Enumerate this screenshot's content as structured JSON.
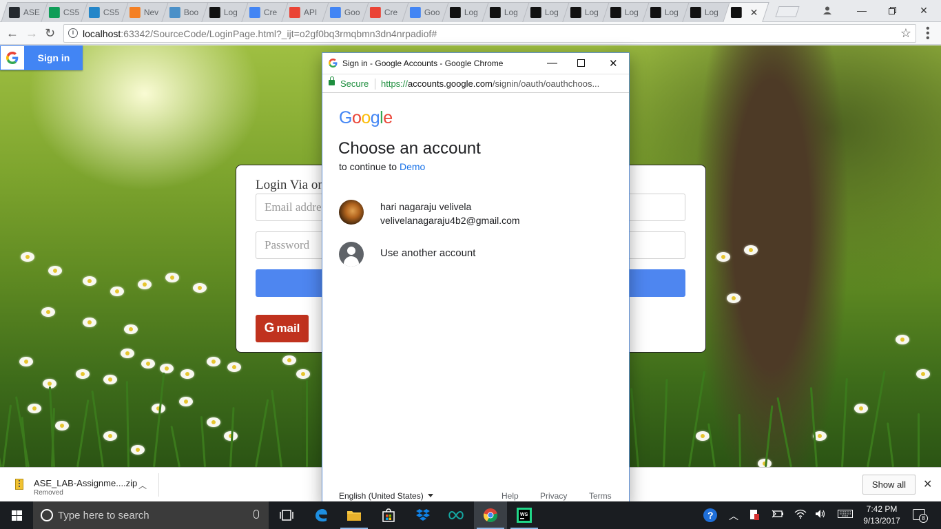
{
  "browser": {
    "tabs": [
      {
        "label": "ASE",
        "icon": "github-icon",
        "color": "#24292e"
      },
      {
        "label": "CS5",
        "icon": "sheets-icon",
        "color": "#0f9d58"
      },
      {
        "label": "CS5",
        "icon": "box-icon",
        "color": "#2486c9"
      },
      {
        "label": "Nev",
        "icon": "stackoverflow-icon",
        "color": "#f48024"
      },
      {
        "label": "Boo",
        "icon": "bootstrap-icon",
        "color": "#4a90c8"
      },
      {
        "label": "Log",
        "icon": "webstorm-icon",
        "color": "#111111"
      },
      {
        "label": "Cre",
        "icon": "chrome-dev-icon",
        "color": "#4285f4"
      },
      {
        "label": "API",
        "icon": "google-icon",
        "color": "#ea4335"
      },
      {
        "label": "Goo",
        "icon": "chrome-dev-icon",
        "color": "#4285f4"
      },
      {
        "label": "Cre",
        "icon": "google-icon",
        "color": "#ea4335"
      },
      {
        "label": "Goo",
        "icon": "chrome-dev-icon",
        "color": "#4285f4"
      },
      {
        "label": "Log",
        "icon": "webstorm-icon",
        "color": "#111111"
      },
      {
        "label": "Log",
        "icon": "webstorm-icon",
        "color": "#111111"
      },
      {
        "label": "Log",
        "icon": "webstorm-icon",
        "color": "#111111"
      },
      {
        "label": "Log",
        "icon": "webstorm-icon",
        "color": "#111111"
      },
      {
        "label": "Log",
        "icon": "webstorm-icon",
        "color": "#111111"
      },
      {
        "label": "Log",
        "icon": "webstorm-icon",
        "color": "#111111"
      },
      {
        "label": "Log",
        "icon": "webstorm-icon",
        "color": "#111111"
      }
    ],
    "active_tab_close": "✕",
    "url_host": "localhost",
    "url_rest": ":63342/SourceCode/LoginPage.html?_ijt=o2gf0bq3rmqbmn3dn4nrpadiof#",
    "star_icon": "☆"
  },
  "page": {
    "google_signin_label": "Sign in",
    "login_title": "Login Via on",
    "email_placeholder": "Email addre",
    "password_placeholder": "Password",
    "gmail_button_g": "G",
    "gmail_button_label": "mail"
  },
  "popup": {
    "window_title": "Sign in - Google Accounts - Google Chrome",
    "secure_label": "Secure",
    "url_proto": "https://",
    "url_domain": "accounts.google.com",
    "url_path": "/signin/oauth/oauthchoos...",
    "logo_letters": [
      "G",
      "o",
      "o",
      "g",
      "l",
      "e"
    ],
    "logo_colors": [
      "#4285f4",
      "#ea4335",
      "#fbbc05",
      "#4285f4",
      "#34a853",
      "#ea4335"
    ],
    "heading": "Choose an account",
    "continue_prefix": "to continue to",
    "continue_app": "Demo",
    "account_name": "hari nagaraju velivela",
    "account_email": "velivelanagaraju4b2@gmail.com",
    "use_another": "Use another account",
    "language": "English (United States)",
    "footer_help": "Help",
    "footer_privacy": "Privacy",
    "footer_terms": "Terms"
  },
  "downloads": {
    "file_name": "ASE_LAB-Assignme....zip",
    "file_status": "Removed",
    "show_all": "Show all"
  },
  "taskbar": {
    "search_placeholder": "Type here to search",
    "time": "7:42 PM",
    "date": "9/13/2017",
    "notification_count": "8"
  }
}
